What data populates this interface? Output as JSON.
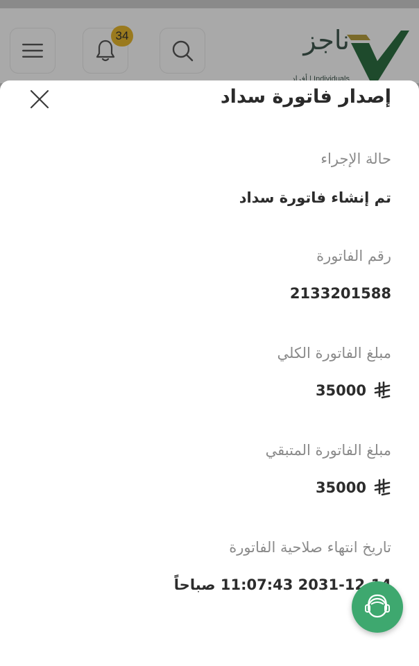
{
  "header": {
    "notification_count": "34",
    "logo": {
      "brand": "ناجز",
      "subtitle": "أفراد | Individuals"
    },
    "icons": {
      "menu": "hamburger-menu-icon",
      "notifications": "bell-icon",
      "search": "search-icon"
    }
  },
  "sheet": {
    "title": "إصدار فاتورة سداد",
    "fields": [
      {
        "label": "حالة الإجراء",
        "value": "تم إنشاء فاتورة سداد"
      },
      {
        "label": "رقم الفاتورة",
        "value": "2133201588"
      },
      {
        "label": "مبلغ الفاتورة الكلي",
        "value": "35000",
        "currency_icon": "saudi-riyal-icon"
      },
      {
        "label": "مبلغ الفاتورة المتبقي",
        "value": "35000",
        "currency_icon": "saudi-riyal-icon"
      },
      {
        "label": "تاريخ انتهاء صلاحية الفاتورة",
        "value": "2031-12-14 11:07:43 صباحاً"
      }
    ]
  },
  "colors": {
    "accent_green": "#3ea86f",
    "badge": "#9a7a1e",
    "logo_green": "#1e6b3a"
  }
}
